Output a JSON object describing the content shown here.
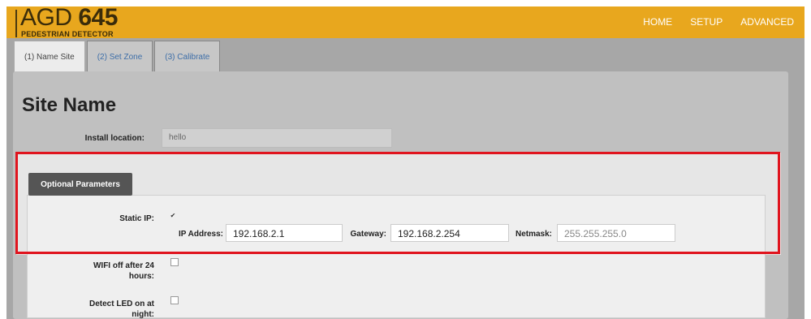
{
  "app": {
    "brand_prefix": "AGD",
    "brand_model": "645",
    "subtitle": "PEDESTRIAN DETECTOR"
  },
  "nav": [
    {
      "label": "HOME"
    },
    {
      "label": "SETUP"
    },
    {
      "label": "ADVANCED"
    }
  ],
  "tabs": [
    {
      "label": "(1) Name Site",
      "active": true
    },
    {
      "label": "(2) Set Zone",
      "active": false
    },
    {
      "label": "(3) Calibrate",
      "active": false
    }
  ],
  "page": {
    "title": "Site Name",
    "install_location_label": "Install location:",
    "install_location_value": "hello"
  },
  "optional": {
    "button_label": "Optional Parameters",
    "static_ip_label": "Static IP:",
    "static_ip_checked": true,
    "ip_label": "IP Address:",
    "ip_value": "192.168.2.1",
    "gateway_label": "Gateway:",
    "gateway_value": "192.168.2.254",
    "netmask_label": "Netmask:",
    "netmask_value": "255.255.255.0",
    "wifi_label_1": "WIFI off after 24",
    "wifi_label_2": "hours:",
    "detect_label_1": "Detect LED on at",
    "detect_label_2": "night:"
  },
  "colors": {
    "topbar": "#e8a71e",
    "highlight": "#e0141e"
  }
}
